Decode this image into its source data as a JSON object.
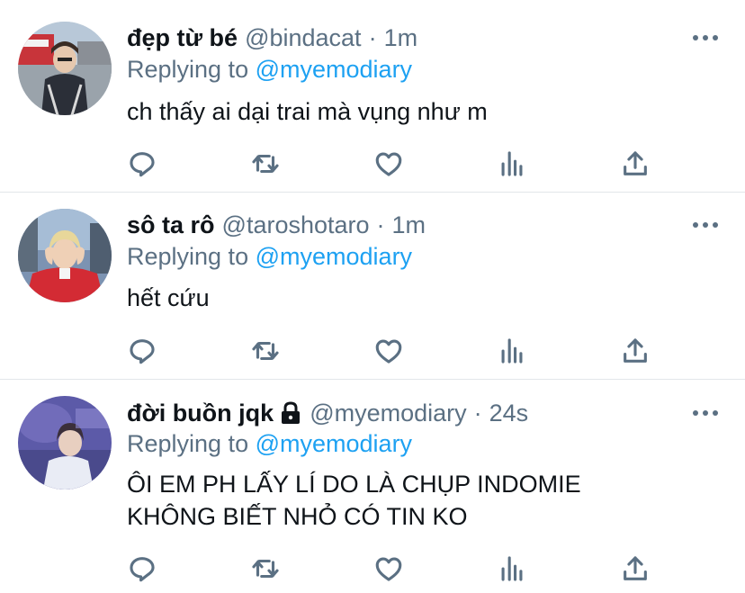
{
  "replies": [
    {
      "display_name": "đẹp từ bé",
      "handle": "@bindacat",
      "separator": "·",
      "time": "1m",
      "replying_prefix": "Replying to",
      "replying_to": "@myemodiary",
      "text_lines": [
        "ch thấy ai dại trai mà vụng như m"
      ],
      "protected": false
    },
    {
      "display_name": "sô ta rô",
      "handle": "@taroshotaro",
      "separator": "·",
      "time": "1m",
      "replying_prefix": "Replying to",
      "replying_to": "@myemodiary",
      "text_lines": [
        "hết cứu"
      ],
      "protected": false
    },
    {
      "display_name": "đời buồn jqk",
      "handle": "@myemodiary",
      "separator": "·",
      "time": "24s",
      "replying_prefix": "Replying to",
      "replying_to": "@myemodiary",
      "text_lines": [
        "ÔI EM PH LẤY LÍ DO LÀ CHỤP INDOMIE",
        "KHÔNG BIẾT NHỎ CÓ TIN KO"
      ],
      "protected": true
    }
  ],
  "icons": {
    "reply": "reply-icon",
    "retweet": "retweet-icon",
    "like": "heart-icon",
    "stats": "analytics-icon",
    "share": "share-icon",
    "more": "more-icon",
    "lock": "lock-icon"
  },
  "colors": {
    "text": "#0f1419",
    "secondary": "#5b7083",
    "mention": "#1da1f2",
    "divider": "#e2e6ea"
  }
}
